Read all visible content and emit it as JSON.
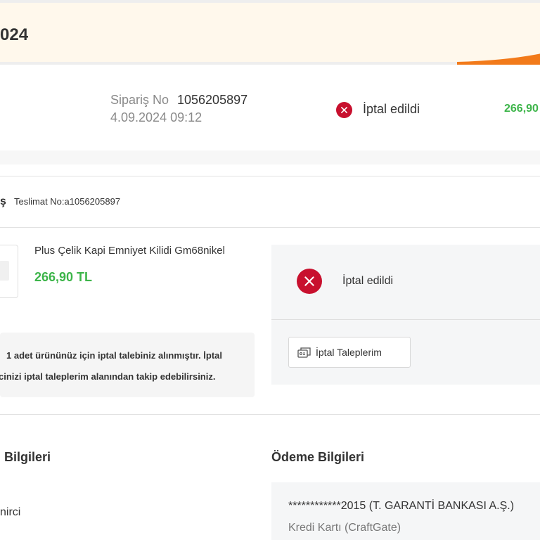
{
  "header": {
    "title_fragment": "024"
  },
  "order_summary": {
    "order_label": "Sipariş No",
    "order_number": "1056205897",
    "order_date": "4.09.2024 09:12",
    "status": "İptal edildi",
    "price_fragment": "266,90"
  },
  "shipment": {
    "prefix_fragment": "ş",
    "delivery_label": "Teslimat No:a1056205897"
  },
  "product": {
    "name": "Plus Çelik Kapi Emniyet Kilidi Gm68nikel",
    "price": "266,90 TL"
  },
  "cancel_info": {
    "line1": "1 adet ürününüz için iptal talebiniz alınmıştır. İptal",
    "line2": "cinizi iptal taleplerim alanından takip edebilirsiniz."
  },
  "status_panel": {
    "status": "İptal edildi",
    "button_label": "İptal Taleplerim"
  },
  "sections": {
    "left_title_fragment": "Bilgileri",
    "right_title": "Ödeme Bilgileri"
  },
  "address": {
    "name_fragment": "nirci"
  },
  "payment": {
    "card_line": "************2015 (T. GARANTİ BANKASI A.Ş.)",
    "card_type": "Kredi Kartı (CraftGate)"
  },
  "colors": {
    "accent_orange": "#f27a1a",
    "price_green": "#3db54a",
    "cancel_red": "#c8102e"
  },
  "icons": {
    "status": "x-circle-icon",
    "button": "ticket-icon"
  }
}
